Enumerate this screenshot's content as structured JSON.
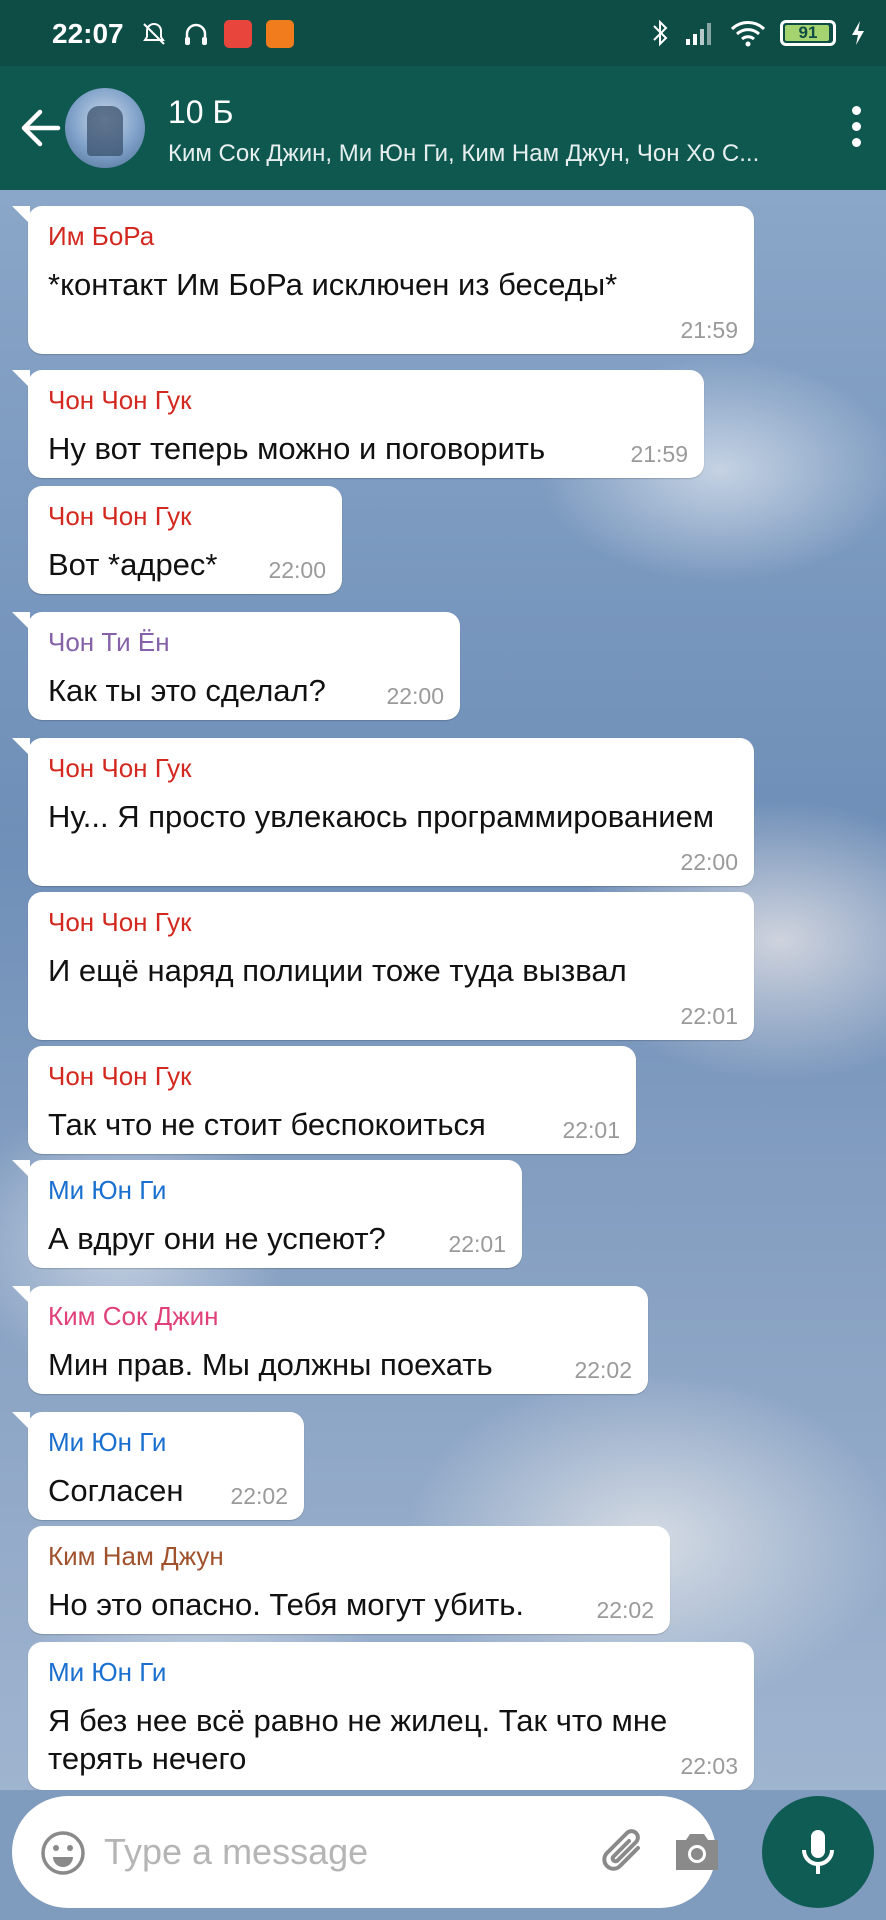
{
  "status_bar": {
    "time": "22:07",
    "battery": "91",
    "left_icons": [
      "silent-bell-icon",
      "headphones-icon",
      "music-app-icon",
      "mi-app-icon"
    ],
    "right_icons": [
      "bluetooth-icon",
      "signal-icon",
      "wifi-icon",
      "battery-icon",
      "charging-icon"
    ]
  },
  "header": {
    "title": "10 Б",
    "members": "Ким Сок Джин, Ми Юн Ги, Ким Нам Джун, Чон Хо С..."
  },
  "colors": {
    "header_bg": "#0e5850",
    "status_bg": "#0e4c46",
    "mic_bg": "#0f5c55",
    "sender_red": "#d2281f",
    "sender_purple": "#8561a8",
    "sender_blue": "#1a6fcf",
    "sender_pink": "#e0417a",
    "sender_brown": "#a0522d"
  },
  "messages": [
    {
      "sender": "Им БоРа",
      "text": "*контакт Им БоРа исключен из беседы*",
      "time": "21:59",
      "color": "#d2281f"
    },
    {
      "sender": "Чон Чон Гук",
      "text": "Ну вот теперь можно и поговорить",
      "time": "21:59",
      "color": "#d2281f"
    },
    {
      "sender": "Чон Чон Гук",
      "text": "Вот *адрес*",
      "time": "22:00",
      "color": "#d2281f"
    },
    {
      "sender": "Чон Ти Ён",
      "text": "Как ты это сделал?",
      "time": "22:00",
      "color": "#8561a8"
    },
    {
      "sender": "Чон Чон Гук",
      "text": "Ну... Я просто увлекаюсь программированием",
      "time": "22:00",
      "color": "#d2281f"
    },
    {
      "sender": "Чон Чон Гук",
      "text": "И ещё наряд полиции тоже туда вызвал",
      "time": "22:01",
      "color": "#d2281f"
    },
    {
      "sender": "Чон Чон Гук",
      "text": "Так что не стоит беспокоиться",
      "time": "22:01",
      "color": "#d2281f"
    },
    {
      "sender": "Ми Юн Ги",
      "text": "А вдруг они не успеют?",
      "time": "22:01",
      "color": "#1a6fcf"
    },
    {
      "sender": "Ким Сок Джин",
      "text": "Мин прав. Мы должны поехать",
      "time": "22:02",
      "color": "#e0417a"
    },
    {
      "sender": "Ми Юн Ги",
      "text": "Согласен",
      "time": "22:02",
      "color": "#1a6fcf"
    },
    {
      "sender": "Ким Нам Джун",
      "text": "Но это опасно. Тебя могут убить.",
      "time": "22:02",
      "color": "#a0522d"
    },
    {
      "sender": "Ми Юн Ги",
      "text": "Я без нее всё равно не жилец. Так что мне терять нечего",
      "time": "22:03",
      "color": "#1a6fcf"
    }
  ],
  "input": {
    "placeholder": "Type a message"
  }
}
